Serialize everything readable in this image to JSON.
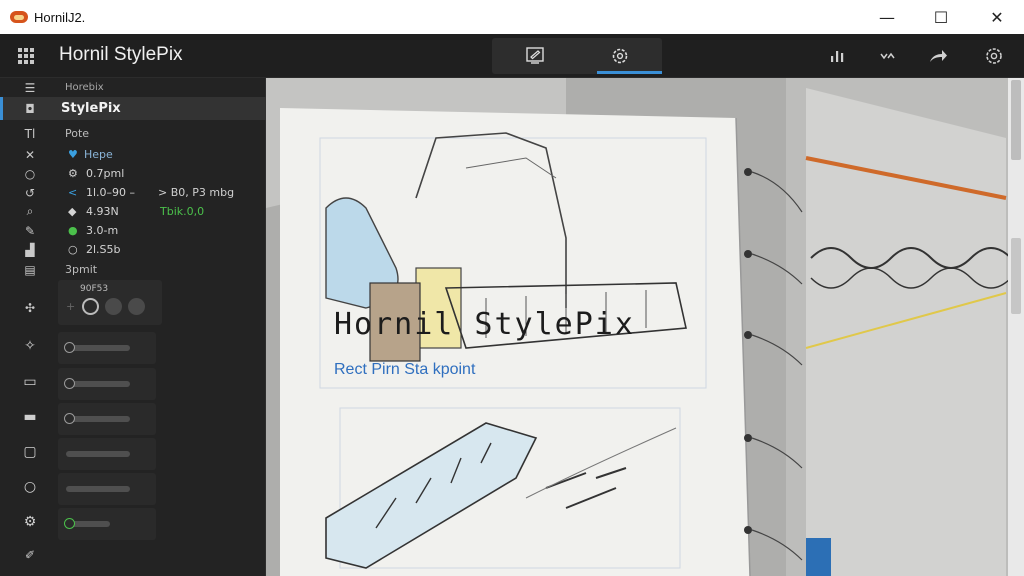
{
  "window": {
    "title": "HornilJ2.",
    "minimize": "—",
    "maximize": "☐",
    "close": "✕"
  },
  "header": {
    "title": "Hornil StylePix",
    "tabs": [
      {
        "icon": "image-edit-icon"
      },
      {
        "icon": "settings-cog-icon"
      }
    ],
    "right_icons": [
      "bar-chart-icon",
      "sync-icon",
      "share-icon",
      "settings-icon"
    ]
  },
  "sidebar": {
    "top_label": "Horebix",
    "active_item": "StylePix",
    "section1": "Pote",
    "items": [
      {
        "text": "Hepe",
        "marker": "♥"
      },
      {
        "text": "0.7pml"
      },
      {
        "text": "1l.0–90 –",
        "extra1": "> B0, P3 mbg"
      },
      {
        "text": "4.93N",
        "extra1": "Tbik.0,0"
      },
      {
        "text": "3.0-m"
      },
      {
        "text": "2l.S5b"
      }
    ],
    "section2": "3pmit",
    "swatch_label": "90F53"
  },
  "canvas": {
    "title": "Hornil StylePix",
    "subtitle": "Rect Pirn Sta kpoint"
  },
  "colors": {
    "accent": "#3a8fd6",
    "title_bar": "#ffffff",
    "sidebar_bg": "#232323",
    "canvas_text": "#1c1c1c",
    "link": "#2f6fbf"
  }
}
